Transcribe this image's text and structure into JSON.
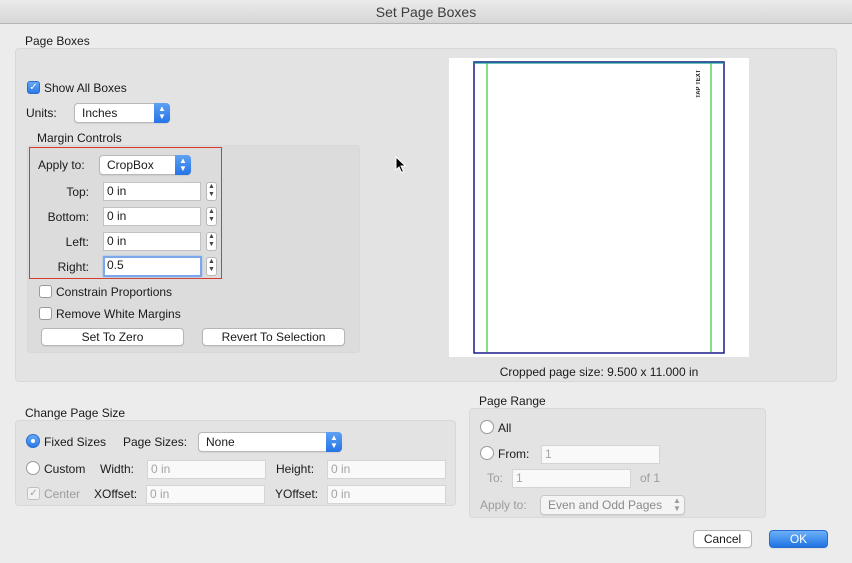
{
  "window": {
    "title": "Set Page Boxes"
  },
  "page_boxes": {
    "label": "Page Boxes",
    "show_all_boxes": {
      "label": "Show All Boxes",
      "checked": true
    },
    "units": {
      "label": "Units:",
      "value": "Inches"
    },
    "margin_controls": {
      "label": "Margin Controls",
      "apply_to": {
        "label": "Apply to:",
        "value": "CropBox"
      },
      "top": {
        "label": "Top:",
        "value": "0 in"
      },
      "bottom": {
        "label": "Bottom:",
        "value": "0 in"
      },
      "left": {
        "label": "Left:",
        "value": "0 in"
      },
      "right": {
        "label": "Right:",
        "value": "0.5"
      },
      "constrain_proportions": {
        "label": "Constrain Proportions",
        "checked": false
      },
      "remove_white_margins": {
        "label": "Remove White Margins",
        "checked": false
      },
      "set_to_zero": "Set To Zero",
      "revert_to_selection": "Revert To Selection"
    },
    "preview": {
      "page_text": "TAP TEXT",
      "cropped_size": "Cropped page size: 9.500 x 11.000 in"
    }
  },
  "change_page_size": {
    "label": "Change Page Size",
    "fixed_sizes": {
      "label": "Fixed Sizes",
      "selected": true
    },
    "page_sizes": {
      "label": "Page Sizes:",
      "value": "None"
    },
    "custom": {
      "label": "Custom",
      "selected": false
    },
    "width": {
      "label": "Width:",
      "placeholder": "0 in"
    },
    "height": {
      "label": "Height:",
      "placeholder": "0 in"
    },
    "center": {
      "label": "Center",
      "checked": true
    },
    "xoffset": {
      "label": "XOffset:",
      "placeholder": "0 in"
    },
    "yoffset": {
      "label": "YOffset:",
      "placeholder": "0 in"
    }
  },
  "page_range": {
    "label": "Page Range",
    "all": {
      "label": "All",
      "selected": false
    },
    "from": {
      "label": "From:",
      "placeholder": "1"
    },
    "to": {
      "label": "To:",
      "placeholder": "1",
      "of": "of 1"
    },
    "apply_to": {
      "label": "Apply to:",
      "value": "Even and Odd Pages"
    }
  },
  "buttons": {
    "cancel": "Cancel",
    "ok": "OK"
  },
  "colors": {
    "accent": "#2b7ae8",
    "highlight_box": "#d63b2e",
    "media_box": "#1a1a8c",
    "crop_box": "#2ecc40",
    "bleed_box": "#1a9a9a"
  }
}
